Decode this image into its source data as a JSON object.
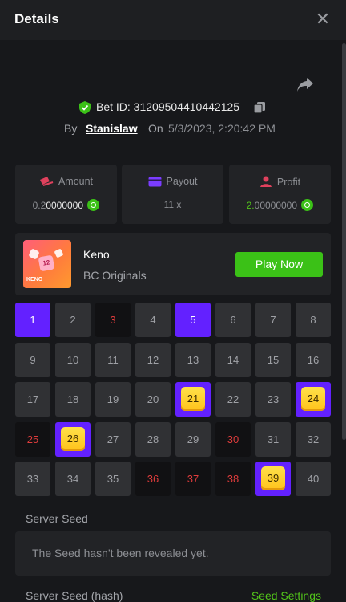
{
  "header": {
    "title": "Details",
    "close_icon": "close-icon"
  },
  "bet": {
    "id_label": "Bet ID: 31209504410442125",
    "by_label": "By",
    "username": "Stanislaw",
    "on_label": "On",
    "datetime": "5/3/2023, 2:20:42 PM"
  },
  "stats": {
    "amount": {
      "label": "Amount",
      "value_prefix": "0.2",
      "value_suffix": "0000000",
      "icon": "amount-icon"
    },
    "payout": {
      "label": "Payout",
      "value": "11 x",
      "icon": "payout-icon"
    },
    "profit": {
      "label": "Profit",
      "value_prefix": "2.",
      "value_suffix": "00000000",
      "icon": "profit-icon"
    }
  },
  "game": {
    "name": "Keno",
    "provider": "BC Originals",
    "play_label": "Play Now",
    "thumb_number": "12",
    "thumb_label": "KENO"
  },
  "tiles": [
    {
      "n": "1",
      "state": "sel"
    },
    {
      "n": "2",
      "state": ""
    },
    {
      "n": "3",
      "state": "miss"
    },
    {
      "n": "4",
      "state": ""
    },
    {
      "n": "5",
      "state": "sel"
    },
    {
      "n": "6",
      "state": ""
    },
    {
      "n": "7",
      "state": ""
    },
    {
      "n": "8",
      "state": ""
    },
    {
      "n": "9",
      "state": ""
    },
    {
      "n": "10",
      "state": ""
    },
    {
      "n": "11",
      "state": ""
    },
    {
      "n": "12",
      "state": ""
    },
    {
      "n": "13",
      "state": ""
    },
    {
      "n": "14",
      "state": ""
    },
    {
      "n": "15",
      "state": ""
    },
    {
      "n": "16",
      "state": ""
    },
    {
      "n": "17",
      "state": ""
    },
    {
      "n": "18",
      "state": ""
    },
    {
      "n": "19",
      "state": ""
    },
    {
      "n": "20",
      "state": ""
    },
    {
      "n": "21",
      "state": "hit"
    },
    {
      "n": "22",
      "state": ""
    },
    {
      "n": "23",
      "state": ""
    },
    {
      "n": "24",
      "state": "hit"
    },
    {
      "n": "25",
      "state": "miss"
    },
    {
      "n": "26",
      "state": "hit"
    },
    {
      "n": "27",
      "state": ""
    },
    {
      "n": "28",
      "state": ""
    },
    {
      "n": "29",
      "state": ""
    },
    {
      "n": "30",
      "state": "miss"
    },
    {
      "n": "31",
      "state": ""
    },
    {
      "n": "32",
      "state": ""
    },
    {
      "n": "33",
      "state": ""
    },
    {
      "n": "34",
      "state": ""
    },
    {
      "n": "35",
      "state": ""
    },
    {
      "n": "36",
      "state": "miss"
    },
    {
      "n": "37",
      "state": "miss"
    },
    {
      "n": "38",
      "state": "miss"
    },
    {
      "n": "39",
      "state": "hit"
    },
    {
      "n": "40",
      "state": ""
    }
  ],
  "seeds": {
    "server_seed_label": "Server Seed",
    "server_seed_value": "The Seed hasn't been revealed yet.",
    "server_seed_hash_label": "Server Seed (hash)",
    "seed_settings_label": "Seed Settings"
  },
  "colors": {
    "accent_green": "#3bc117",
    "selected_purple": "#6321ff",
    "miss_red": "#e03c3c",
    "gem_yellow": "#ffc21a"
  }
}
